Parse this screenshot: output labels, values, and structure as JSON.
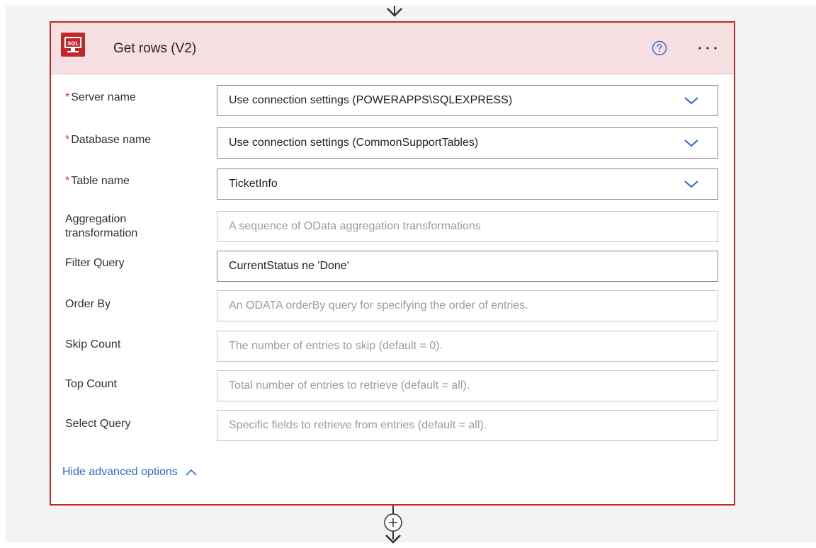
{
  "card": {
    "title": "Get rows (V2)",
    "icon_text": "SQL",
    "accent_color": "#c2272d",
    "header_bg": "#f6dfe0"
  },
  "fields": [
    {
      "label": "Server name",
      "required": true,
      "value": "Use connection settings (POWERAPPS\\SQLEXPRESS)",
      "placeholder": "",
      "dropdown": true
    },
    {
      "label": "Database name",
      "required": true,
      "value": "Use connection settings (CommonSupportTables)",
      "placeholder": "",
      "dropdown": true
    },
    {
      "label": "Table name",
      "required": true,
      "value": "TicketInfo",
      "placeholder": "",
      "dropdown": true
    },
    {
      "label": "Aggregation transformation",
      "required": false,
      "value": "",
      "placeholder": "A sequence of OData aggregation transformations",
      "dropdown": false
    },
    {
      "label": "Filter Query",
      "required": false,
      "value": "CurrentStatus ne 'Done'",
      "placeholder": "",
      "dropdown": false
    },
    {
      "label": "Order By",
      "required": false,
      "value": "",
      "placeholder": "An ODATA orderBy query for specifying the order of entries.",
      "dropdown": false
    },
    {
      "label": "Skip Count",
      "required": false,
      "value": "",
      "placeholder": "The number of entries to skip (default = 0).",
      "dropdown": false
    },
    {
      "label": "Top Count",
      "required": false,
      "value": "",
      "placeholder": "Total number of entries to retrieve (default = all).",
      "dropdown": false
    },
    {
      "label": "Select Query",
      "required": false,
      "value": "",
      "placeholder": "Specific fields to retrieve from entries (default = all).",
      "dropdown": false
    }
  ],
  "advanced": {
    "toggle_label": "Hide advanced options"
  },
  "icons": {
    "help": "help-circle-icon",
    "more": "more-options-icon",
    "chevron": "chevron-down-icon",
    "add": "add-step-icon"
  }
}
